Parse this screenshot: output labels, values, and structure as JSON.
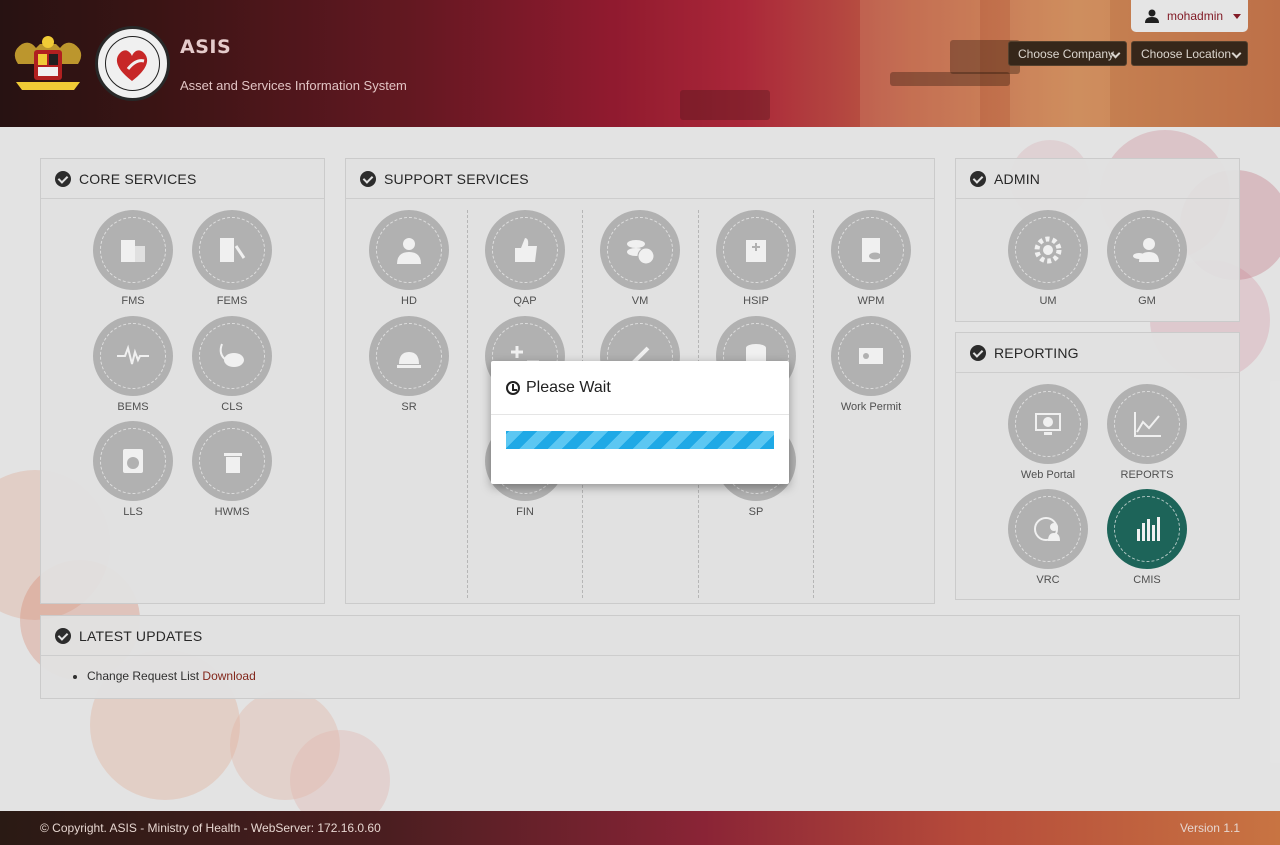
{
  "header": {
    "app_title": "ASIS",
    "app_subtitle": "Asset and Services Information System",
    "user_name": "mohadmin",
    "company_select": "Choose Company",
    "location_select": "Choose Location"
  },
  "core_services": {
    "title": "CORE SERVICES",
    "items": [
      {
        "label": "FMS",
        "icon": "building-icon"
      },
      {
        "label": "FEMS",
        "icon": "facility-tools-icon"
      },
      {
        "label": "BEMS",
        "icon": "heartbeat-icon"
      },
      {
        "label": "CLS",
        "icon": "vacuum-cleaner-icon"
      },
      {
        "label": "LLS",
        "icon": "washing-machine-icon"
      },
      {
        "label": "HWMS",
        "icon": "waste-bin-icon"
      }
    ]
  },
  "support_services": {
    "title": "SUPPORT SERVICES",
    "items": [
      {
        "label": "HD",
        "icon": "headset-user-icon"
      },
      {
        "label": "QAP",
        "icon": "thumbs-up-icon"
      },
      {
        "label": "VM",
        "icon": "coins-icon"
      },
      {
        "label": "HSIP",
        "icon": "hospital-icon"
      },
      {
        "label": "WPM",
        "icon": "clipboard-eye-icon"
      },
      {
        "label": "SR",
        "icon": "service-bell-icon"
      },
      {
        "label": "",
        "icon": "plus-minus-icon"
      },
      {
        "label": "",
        "icon": "tools-icon"
      },
      {
        "label": "",
        "icon": "database-icon"
      },
      {
        "label": "Work Permit",
        "icon": "id-card-icon"
      },
      {
        "label": "FIN",
        "icon": "finance-icon"
      },
      {
        "label": "SP",
        "icon": "sp-icon"
      }
    ]
  },
  "admin": {
    "title": "ADMIN",
    "items": [
      {
        "label": "UM",
        "icon": "gear-icon"
      },
      {
        "label": "GM",
        "icon": "user-coins-icon"
      }
    ]
  },
  "reporting": {
    "title": "REPORTING",
    "items": [
      {
        "label": "Web Portal",
        "icon": "monitor-globe-icon"
      },
      {
        "label": "REPORTS",
        "icon": "line-chart-icon"
      },
      {
        "label": "VRC",
        "icon": "globe-user-icon"
      },
      {
        "label": "CMIS",
        "icon": "bar-chart-icon"
      }
    ],
    "active_color": "#1f6b5f"
  },
  "latest_updates": {
    "title": "LATEST UPDATES",
    "item_text": "Change Request List ",
    "item_link": "Download"
  },
  "modal": {
    "title": "Please Wait",
    "progress": 1.0
  },
  "footer": {
    "copyright": "© Copyright. ASIS - Ministry of Health - WebServer: 172.16.0.60",
    "version": "Version 1.1"
  },
  "colors": {
    "brand": "#8b1e2a",
    "progress": "#1fa9e6"
  }
}
